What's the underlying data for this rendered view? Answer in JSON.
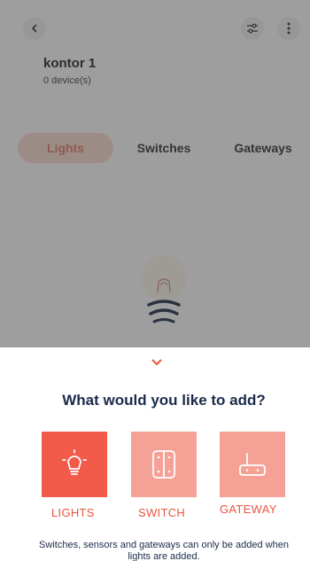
{
  "room": {
    "name": "kontor 1",
    "device_count": "0 device(s)"
  },
  "tabs": [
    {
      "label": "Lights",
      "active": true
    },
    {
      "label": "Switches",
      "active": false
    },
    {
      "label": "Gateways",
      "active": false
    }
  ],
  "icons": {
    "back": "chevron-left-icon",
    "filter": "sliders-icon",
    "more": "more-vertical-icon",
    "empty_state": "lightbulb-icon",
    "collapse": "chevron-down-icon",
    "lights": "lightbulb-icon",
    "switch": "light-switch-icon",
    "gateway": "router-icon"
  },
  "sheet": {
    "title": "What would you like to add?",
    "options": [
      {
        "label": "LIGHTS",
        "selected": true
      },
      {
        "label": "SWITCH",
        "selected": false
      },
      {
        "label": "GATEWAY",
        "selected": false
      }
    ],
    "note": "Switches, sensors and gateways can only be added when lights are added."
  },
  "colors": {
    "accent": "#f25a4a",
    "accent_light": "#f6a196",
    "label": "#e8553f",
    "title": "#1b2a4a"
  }
}
